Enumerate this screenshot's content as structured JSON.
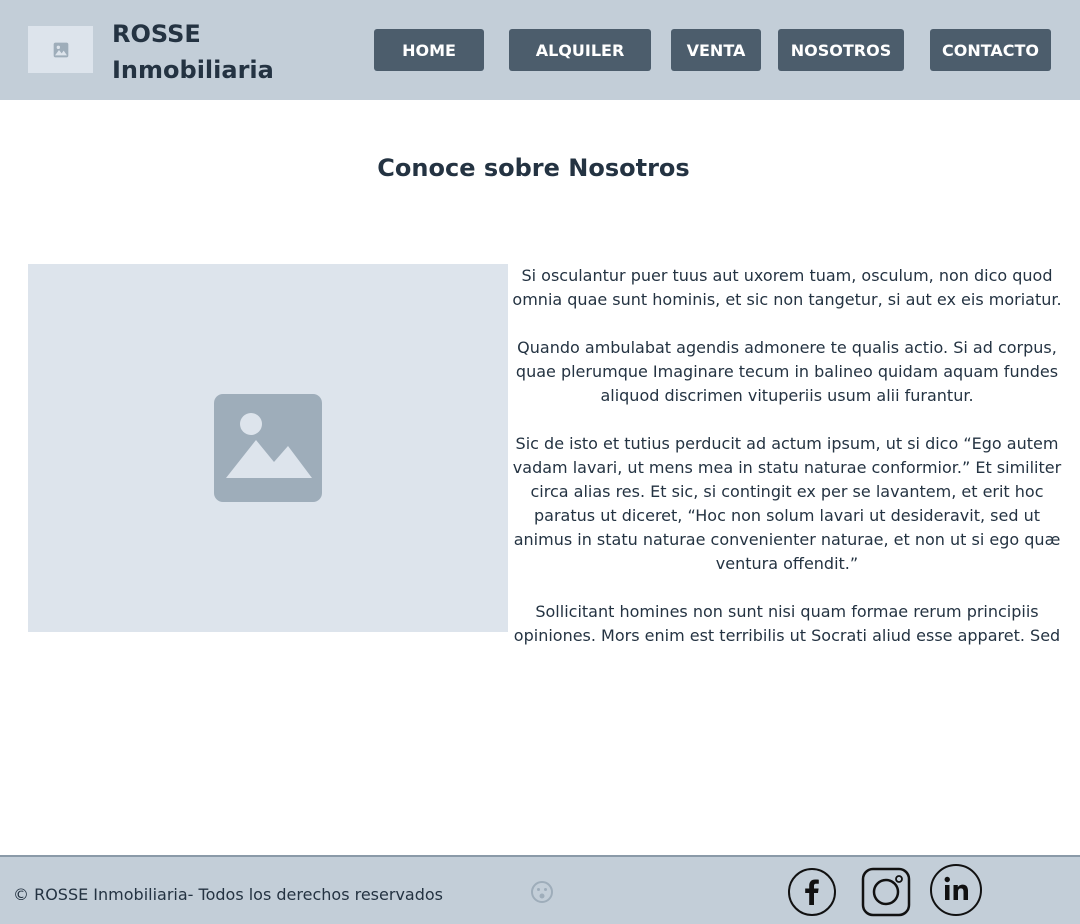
{
  "header": {
    "brand_line1": "ROSSE",
    "brand_line2": "Inmobiliaria",
    "logo_icon": "image-placeholder-icon",
    "nav": {
      "home": "HOME",
      "alquiler": "ALQUILER",
      "venta": "VENTA",
      "nosotros": "NOSOTROS",
      "contacto": "CONTACTO"
    }
  },
  "main": {
    "title": "Conoce sobre Nosotros",
    "photo_icon": "image-placeholder-icon",
    "paragraphs": [
      "Si osculantur puer tuus aut uxorem tuam, osculum, non dico quod omnia quae sunt hominis, et sic non tangetur, si aut ex eis moriatur.",
      "Quando ambulabat agendis admonere te qualis actio. Si ad corpus, quae plerumque Imaginare tecum in balineo quidam aquam fundes aliquod discrimen vituperiis usum alii furantur.",
      "Sic de isto et tutius perducit ad actum ipsum, ut si dico “Ego autem vadam lavari, ut mens mea in statu naturae conformior.” Et similiter circa alias res. Et sic, si contingit ex per se lavantem, et erit hoc paratus ut diceret, “Hoc non solum lavari ut desideravit, sed ut animus in statu naturae convenienter naturae, et non ut si ego quæ ventura offendit.”",
      "Sollicitant homines non sunt nisi quam formae rerum principiis opiniones. Mors enim est terribilis ut Socrati aliud esse apparet. Sed timor mortis est notio terribile. Cum igitur impediantur turbentur aut"
    ]
  },
  "footer": {
    "copyright": "© ROSSE Inmobiliaria- Todos los derechos reservados",
    "smiley_icon": "smiley-icon",
    "social": [
      "facebook-icon",
      "instagram-icon",
      "linkedin-icon"
    ]
  },
  "colors": {
    "header_bg": "#c3ced8",
    "button_bg": "#4c5d6c",
    "placeholder_bg": "#dde4ec",
    "placeholder_icon": "#9eadba",
    "text": "#243342"
  }
}
